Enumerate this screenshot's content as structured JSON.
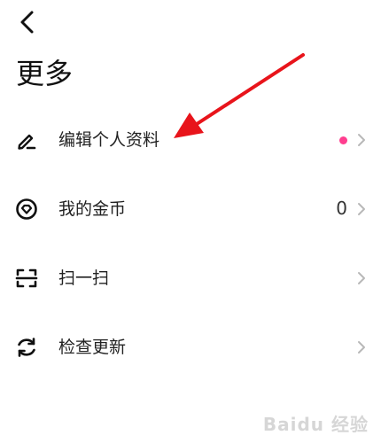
{
  "header": {
    "title": "更多"
  },
  "menu": [
    {
      "label": "编辑个人资料",
      "icon": "edit-pen-icon",
      "badge_color": "#ff3e8f"
    },
    {
      "label": "我的金币",
      "icon": "coin-badge-icon",
      "value": "0"
    },
    {
      "label": "扫一扫",
      "icon": "scan-icon"
    },
    {
      "label": "检查更新",
      "icon": "refresh-icon"
    }
  ],
  "colors": {
    "accent_arrow": "#e8141b",
    "badge": "#ff3e8f",
    "chevron": "#b8b8b8"
  },
  "watermark": "Baidu 经验"
}
